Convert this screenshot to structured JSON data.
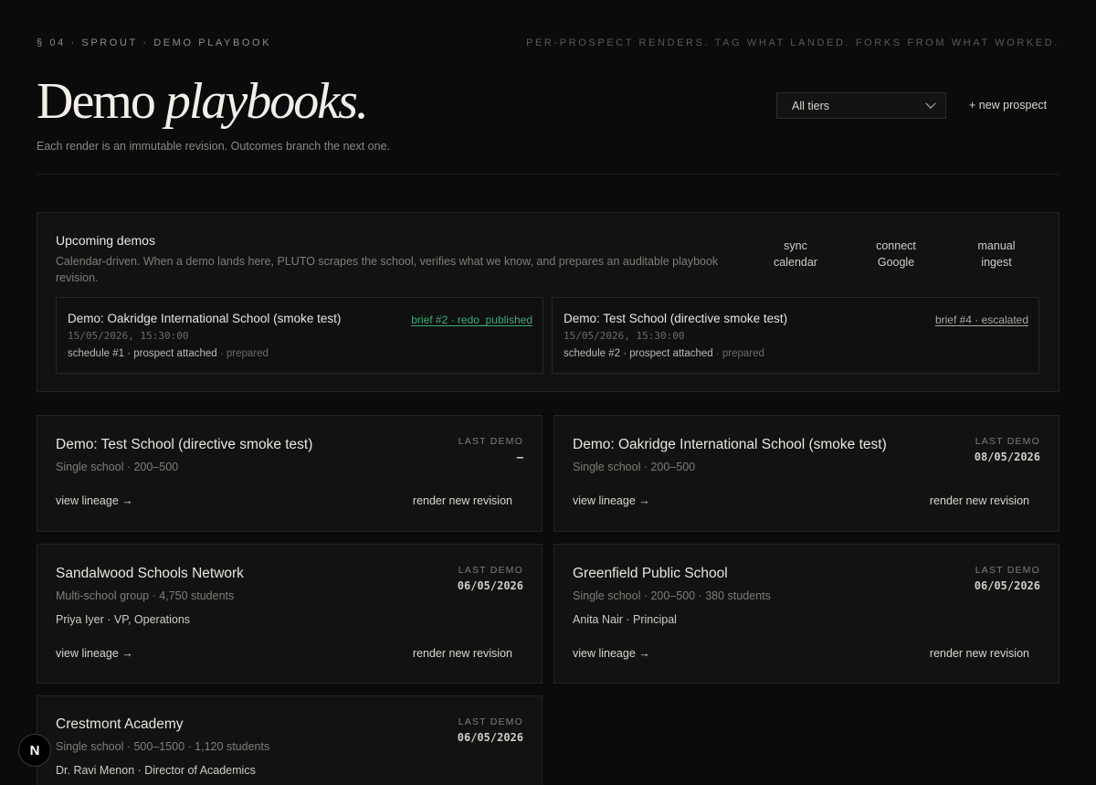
{
  "header": {
    "eyebrow": "§ 04 · SPROUT · DEMO PLAYBOOK",
    "tagline": "PER-PROSPECT RENDERS. TAG WHAT LANDED. FORKS FROM WHAT WORKED.",
    "title_regular": "Demo",
    "title_italic": "playbooks.",
    "subtitle": "Each render is an immutable revision. Outcomes branch the next one.",
    "tier_select": "All tiers",
    "new_prospect": "+ new prospect"
  },
  "upcoming": {
    "title": "Upcoming demos",
    "description": "Calendar-driven. When a demo lands here, PLUTO scrapes the school, verifies what we know, and prepares an auditable playbook revision.",
    "actions": [
      {
        "line1": "sync",
        "line2": "calendar"
      },
      {
        "line1": "connect",
        "line2": "Google"
      },
      {
        "line1": "manual",
        "line2": "ingest"
      }
    ],
    "demos": [
      {
        "title": "Demo: Oakridge International School (smoke test)",
        "time": "15/05/2026, 15:30:00",
        "meta": "schedule #1 · prospect attached",
        "status": " · prepared",
        "brief": "brief #2 · redo_published",
        "brief_color": "#3ca978"
      },
      {
        "title": "Demo: Test School (directive smoke test)",
        "time": "15/05/2026, 15:30:00",
        "meta": "schedule #2 · prospect attached",
        "status": " · prepared",
        "brief": "brief #4 · escalated",
        "brief_color": "#aaa79f"
      }
    ]
  },
  "prospects": {
    "last_demo_label": "LAST DEMO",
    "view_lineage": "view lineage →",
    "render_new": "render new revision",
    "items": [
      {
        "name": "Demo: Test School (directive smoke test)",
        "sub": "Single school · 200–500",
        "contact": "",
        "last_demo": "–"
      },
      {
        "name": "Demo: Oakridge International School (smoke test)",
        "sub": "Single school · 200–500",
        "contact": "",
        "last_demo": "08/05/2026"
      },
      {
        "name": "Sandalwood Schools Network",
        "sub": "Multi-school group · 4,750 students",
        "contact": "Priya Iyer · VP, Operations",
        "last_demo": "06/05/2026"
      },
      {
        "name": "Greenfield Public School",
        "sub": "Single school · 200–500 · 380 students",
        "contact": "Anita Nair · Principal",
        "last_demo": "06/05/2026"
      },
      {
        "name": "Crestmont Academy",
        "sub": "Single school · 500–1500 · 1,120 students",
        "contact": "Dr. Ravi Menon · Director of Academics",
        "last_demo": "06/05/2026"
      }
    ]
  },
  "badge": "N"
}
